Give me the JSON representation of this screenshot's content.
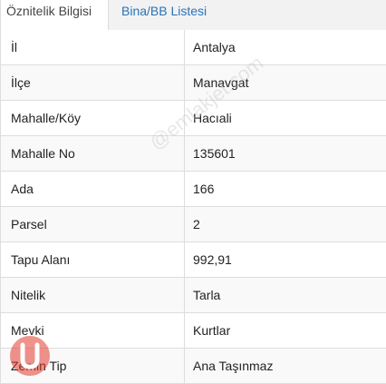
{
  "tabs": [
    {
      "label": "Öznitelik Bilgisi",
      "active": true
    },
    {
      "label": "Bina/BB Listesi",
      "active": false
    }
  ],
  "rows": [
    {
      "label": "İl",
      "value": "Antalya"
    },
    {
      "label": "İlçe",
      "value": "Manavgat"
    },
    {
      "label": "Mahalle/Köy",
      "value": "Hacıali"
    },
    {
      "label": "Mahalle No",
      "value": "135601"
    },
    {
      "label": "Ada",
      "value": "166"
    },
    {
      "label": "Parsel",
      "value": "2"
    },
    {
      "label": "Tapu Alanı",
      "value": "992,91"
    },
    {
      "label": "Nitelik",
      "value": "Tarla"
    },
    {
      "label": "Mevki",
      "value": "Kurtlar"
    },
    {
      "label": "Zemin Tip",
      "value": "Ana Taşınmaz"
    }
  ],
  "watermark": "@emlakjet.com",
  "colors": {
    "tab_link": "#2a73b8",
    "logo_red": "#e23b2e"
  }
}
